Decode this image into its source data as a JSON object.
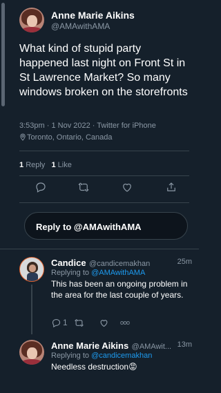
{
  "tweet": {
    "author_name": "Anne Marie Aikins",
    "author_handle": "@AMAwithAMA",
    "text": "What kind of stupid party happened last night on Front St in St Lawrence Market?  So many windows broken on the storefronts",
    "timestamp": "3:53pm · 1 Nov 2022 · Twitter for iPhone",
    "location": "Toronto, Ontario, Canada",
    "stats": {
      "reply_count": "1",
      "reply_label": "Reply",
      "like_count": "1",
      "like_label": "Like"
    },
    "icons": [
      "reply-icon",
      "retweet-icon",
      "like-icon",
      "share-icon"
    ]
  },
  "reply_box": {
    "placeholder": "Reply to @AMAwithAMA"
  },
  "replies": [
    {
      "name": "Candice",
      "handle": "@candicemakhan",
      "time": "25m",
      "replying_prefix": "Replying to ",
      "replying_to": "@AMAwithAMA",
      "text": "This has been an ongoing problem in the area for the last couple of years.",
      "reply_count": "1",
      "more": "ooo"
    },
    {
      "name": "Anne Marie Aikins",
      "handle": "@AMAwit...",
      "time": "13m",
      "replying_prefix": "Replying to ",
      "replying_to": "@candicemakhan",
      "text": "Needless destruction",
      "emoji": "😡"
    }
  ],
  "colors": {
    "background": "#15202b",
    "accent": "#1d9bf0",
    "secondary_text": "#8b98a5",
    "divider": "#38444d"
  }
}
